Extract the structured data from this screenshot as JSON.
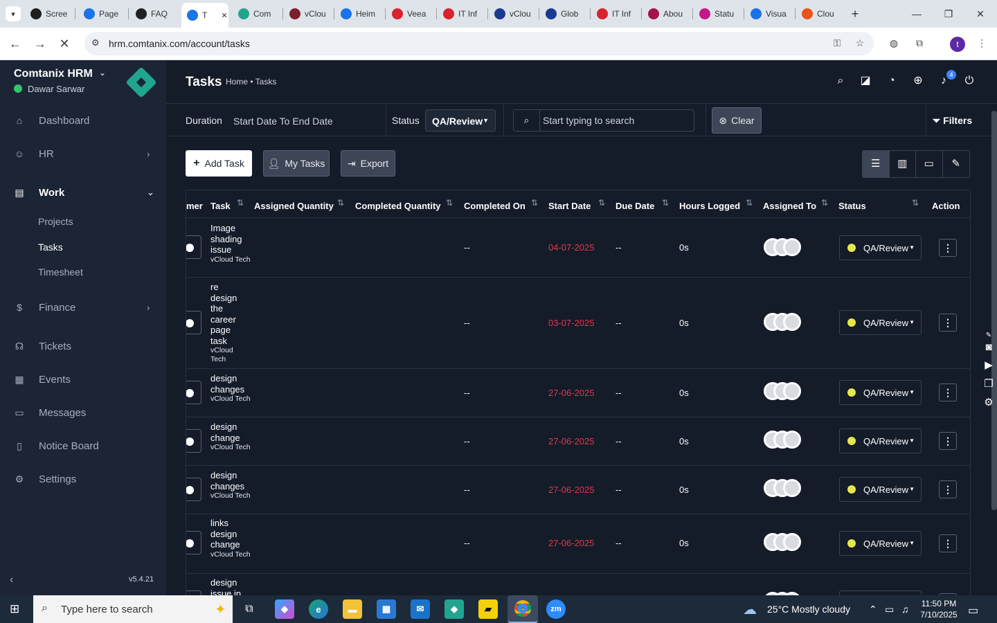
{
  "browser": {
    "tabs": [
      {
        "title": "Scree",
        "color": "#1f1f1f"
      },
      {
        "title": "Page",
        "color": "#1a73e8"
      },
      {
        "title": "FAQ",
        "color": "#202124"
      },
      {
        "title": "T",
        "color": "#1a73e8"
      },
      {
        "title": "Com",
        "color": "#21a58f"
      },
      {
        "title": "vClou",
        "color": "#7a1f2b"
      },
      {
        "title": "Heim",
        "color": "#1a73e8"
      },
      {
        "title": "Veea",
        "color": "#d9232e"
      },
      {
        "title": "IT Inf",
        "color": "#d9232e"
      },
      {
        "title": "vClou",
        "color": "#1a3a8f"
      },
      {
        "title": "Glob",
        "color": "#1a3a8f"
      },
      {
        "title": "IT Inf",
        "color": "#d9232e"
      },
      {
        "title": "Abou",
        "color": "#a3154a"
      },
      {
        "title": "Statu",
        "color": "#c2188a"
      },
      {
        "title": "Visua",
        "color": "#1a73e8"
      },
      {
        "title": "Clou",
        "color": "#e8531a"
      }
    ],
    "url": "hrm.comtanix.com/account/tasks",
    "profile_initial": "t"
  },
  "sidebar": {
    "brand": "Comtanix HRM",
    "user": "Dawar Sarwar",
    "items": [
      {
        "label": "Dashboard",
        "icon": "⌂"
      },
      {
        "label": "HR",
        "icon": "☺"
      },
      {
        "label": "Work",
        "icon": "▤"
      },
      {
        "label": "Finance",
        "icon": "$"
      },
      {
        "label": "Tickets",
        "icon": "☊"
      },
      {
        "label": "Events",
        "icon": "▦"
      },
      {
        "label": "Messages",
        "icon": "▭"
      },
      {
        "label": "Notice Board",
        "icon": "▯"
      },
      {
        "label": "Settings",
        "icon": "⚙"
      }
    ],
    "work_sub": [
      "Projects",
      "Tasks",
      "Timesheet"
    ],
    "version": "v5.4.21"
  },
  "header": {
    "title": "Tasks",
    "breadcrumb": "Home • Tasks",
    "notification_count": "4"
  },
  "filters": {
    "duration_label": "Duration",
    "duration_value": "Start Date To End Date",
    "status_label": "Status",
    "status_value": "QA/Review",
    "search_placeholder": "Start typing to search",
    "clear_label": "Clear",
    "filters_label": "Filters"
  },
  "toolbar": {
    "add_task": "Add Task",
    "my_tasks": "My Tasks",
    "export": "Export"
  },
  "table": {
    "columns": [
      "mer",
      "Task",
      "Assigned Quantity",
      "Completed Quantity",
      "Completed On",
      "Start Date",
      "Due Date",
      "Hours Logged",
      "Assigned To",
      "Status",
      "Action"
    ],
    "rows": [
      {
        "task": "Image shading issue",
        "project": "vCloud Tech",
        "completed_on": "--",
        "start_date": "04-07-2025",
        "due_date": "--",
        "hours": "0s",
        "status": "QA/Review"
      },
      {
        "task": "re design the career page task",
        "project": "vCloud Tech",
        "completed_on": "--",
        "start_date": "03-07-2025",
        "due_date": "--",
        "hours": "0s",
        "status": "QA/Review"
      },
      {
        "task": "design changes",
        "project": "vCloud Tech",
        "completed_on": "--",
        "start_date": "27-06-2025",
        "due_date": "--",
        "hours": "0s",
        "status": "QA/Review"
      },
      {
        "task": "design change",
        "project": "vCloud Tech",
        "completed_on": "--",
        "start_date": "27-06-2025",
        "due_date": "--",
        "hours": "0s",
        "status": "QA/Review"
      },
      {
        "task": "design changes",
        "project": "vCloud Tech",
        "completed_on": "--",
        "start_date": "27-06-2025",
        "due_date": "--",
        "hours": "0s",
        "status": "QA/Review"
      },
      {
        "task": "links design change",
        "project": "vCloud Tech",
        "completed_on": "--",
        "start_date": "27-06-2025",
        "due_date": "--",
        "hours": "0s",
        "status": "QA/Review"
      },
      {
        "task": "design issue in",
        "project": "",
        "completed_on": "",
        "start_date": "",
        "due_date": "",
        "hours": "",
        "status": ""
      }
    ]
  },
  "taskbar": {
    "search_placeholder": "Type here to search",
    "weather": "25°C  Mostly cloudy",
    "time": "11:50 PM",
    "date": "7/10/2025"
  }
}
